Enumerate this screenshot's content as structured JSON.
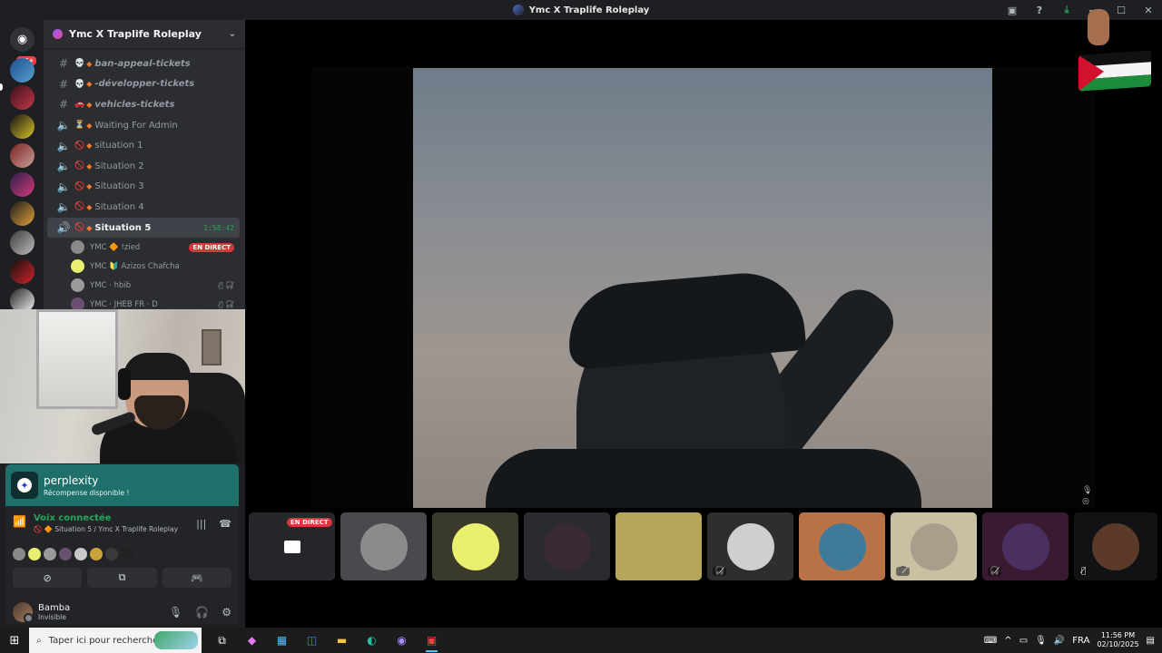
{
  "window": {
    "title": "Ymc X Traplife Roleplay"
  },
  "rail": {
    "home_badge": "1K+"
  },
  "server": {
    "name": "Ymc X Traplife Roleplay",
    "channels": [
      {
        "name": "ban-appeal-tickets",
        "type": "text",
        "emoji": "💀",
        "style": "italic"
      },
      {
        "name": "-développer-tickets",
        "type": "text",
        "emoji": "💀",
        "style": "italic"
      },
      {
        "name": "vehicles-tickets",
        "type": "text",
        "emoji": "🚗",
        "style": "italic"
      },
      {
        "name": "Waiting For Admin",
        "type": "voice",
        "emoji": "⏳",
        "style": "normal"
      },
      {
        "name": "situation 1",
        "type": "voice",
        "emoji": "🚫",
        "style": "normal"
      },
      {
        "name": "Situation 2",
        "type": "voice",
        "emoji": "🚫",
        "style": "normal"
      },
      {
        "name": "Situation 3",
        "type": "voice",
        "emoji": "🚫",
        "style": "normal"
      },
      {
        "name": "Situation 4",
        "type": "voice",
        "emoji": "🚫",
        "style": "normal"
      }
    ],
    "active_channel": {
      "name": "Situation 5",
      "emoji": "🚫",
      "timer": "1:58:42"
    },
    "voice_users": [
      {
        "name": "YMC 🔶 !zied",
        "live": "EN DIRECT"
      },
      {
        "name": "YMC 🔰 Azizos Chafcha",
        "live": ""
      },
      {
        "name": "YMC · hbib",
        "live": ""
      },
      {
        "name": "YMC · JHEB FR · D",
        "live": ""
      }
    ]
  },
  "promo": {
    "name": "perplexity",
    "subtitle": "Récompense disponible !"
  },
  "voice_status": {
    "title": "Voix connectée",
    "subtitle": "🚫 🔶 Situation 5 / Ymc X Traplife Roleplay"
  },
  "user": {
    "name": "Bamba",
    "status": "Invisible"
  },
  "tiles": [
    {
      "kind": "stream",
      "badge": "EN DIRECT",
      "bg": "#26272b",
      "muted": false
    },
    {
      "kind": "avatar",
      "badge": "",
      "bg": "#4a4a4e",
      "av": "#8b8b8b",
      "muted": false
    },
    {
      "kind": "avatar",
      "badge": "",
      "bg": "#3a3a2a",
      "av": "#e9ef6f",
      "muted": false
    },
    {
      "kind": "avatar",
      "badge": "",
      "bg": "#2a2b30",
      "av": "#3a2a35",
      "muted": false
    },
    {
      "kind": "avatar",
      "badge": "",
      "bg": "#b7a55a",
      "av": "#b7a55a",
      "muted": false
    },
    {
      "kind": "avatar",
      "badge": "",
      "bg": "#2e2e31",
      "av": "#cfcfcf",
      "muted": true
    },
    {
      "kind": "avatar",
      "badge": "",
      "bg": "#b87246",
      "av": "#3f7a9a",
      "muted": false
    },
    {
      "kind": "avatar",
      "badge": "",
      "bg": "#c9c0a4",
      "av": "#a79f8b",
      "muted": true
    },
    {
      "kind": "avatar",
      "badge": "",
      "bg": "#3a1a30",
      "av": "#4a2f60",
      "muted": true
    },
    {
      "kind": "avatar",
      "badge": "",
      "bg": "#111214",
      "av": "#5b3a2a",
      "muted": true
    }
  ],
  "taskbar": {
    "search_placeholder": "Taper ici pour rechercher",
    "lang": "FRA",
    "time": "11:56 PM",
    "date": "02/10/2025"
  },
  "colors": {
    "accent_green": "#23a55a",
    "live_red": "#da373c",
    "promo_teal": "#1f6f6b"
  }
}
